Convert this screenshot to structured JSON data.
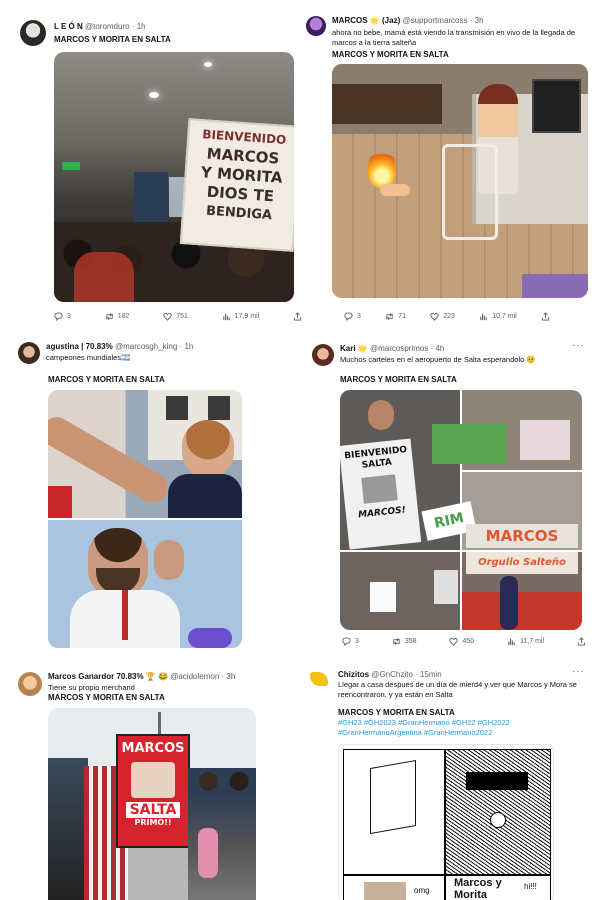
{
  "tweets": [
    {
      "name": "L E Ó N",
      "handle": "@toromduro",
      "time": "· 1h",
      "text": "",
      "bold": "MARCOS Y MORITA EN SALTA",
      "sign": [
        "BIENVENIDO",
        "MARCOS",
        "Y MORITA",
        "DIOS TE",
        "BENDIGA"
      ],
      "metrics": {
        "replies": "3",
        "retweets": "182",
        "likes": "751",
        "views": "17,9 mil"
      }
    },
    {
      "name": "MARCOS",
      "emoji": "🌟",
      "name_suffix": "(Jaz)",
      "handle": "@supportmarcoss",
      "time": "· 3h",
      "text": "ahora no bebe, mamá está viendo la transmisión en vivo de la llegada de marcos a la tierra salteña",
      "bold": "MARCOS Y MORITA EN SALTA",
      "metrics": {
        "replies": "3",
        "retweets": "71",
        "likes": "223",
        "views": "10,7 mil"
      }
    },
    {
      "name": "agustina | 70.83%",
      "handle": "@marcosgh_king",
      "time": "· 1h",
      "text": "campeones mundiales🇦🇷",
      "bold": "MARCOS Y MORITA EN SALTA"
    },
    {
      "name": "Kari",
      "emoji": "🌟",
      "handle": "@marcosprimos",
      "time": "· 4h",
      "text": "Muchos carteles en el aeropuerto de Salta esperandolo 🥺",
      "bold": "MARCOS Y MORITA EN SALTA",
      "signs": [
        "BIENVENIDO SALTA",
        "MARCOS!",
        "MARCOS",
        "Orgullo Salteño",
        "RIM"
      ],
      "metrics": {
        "replies": "3",
        "retweets": "358",
        "likes": "450",
        "views": "11,7 mil"
      }
    },
    {
      "name": "Marcos Ganardor 70.83%",
      "emoji": "🏆 😂",
      "handle": "@acidolemon",
      "time": "· 3h",
      "text": "Tiene su propio merchand",
      "bold": "MARCOS Y MORITA EN SALTA",
      "sign": [
        "MARCOS",
        "SALTA",
        "PRIMO!!"
      ]
    },
    {
      "name": "Chizitos",
      "handle": "@GnChzito",
      "time": "· 15min",
      "text": "Llegar a casa después de un día de mierd4 y ver que Marcos y Mora se reencontraron, y ya están en Salta",
      "bold": "MARCOS Y MORITA EN SALTA",
      "hashtags": "#GH23 #GH2023 #GranHermano #GH22 #GH2022 #GranHermanoArgentina #GranHermano2022",
      "meme": {
        "omg": "omg",
        "caption_1": "Marcos y",
        "caption_2": "Morita",
        "hi": "hi!!!"
      }
    }
  ],
  "colors": {
    "accent": "#1d9bf0",
    "muted": "#536471",
    "orange_sign": "#e4572e"
  },
  "icons": [
    "reply-icon",
    "retweet-icon",
    "like-icon",
    "views-icon",
    "share-icon",
    "more-icon"
  ]
}
